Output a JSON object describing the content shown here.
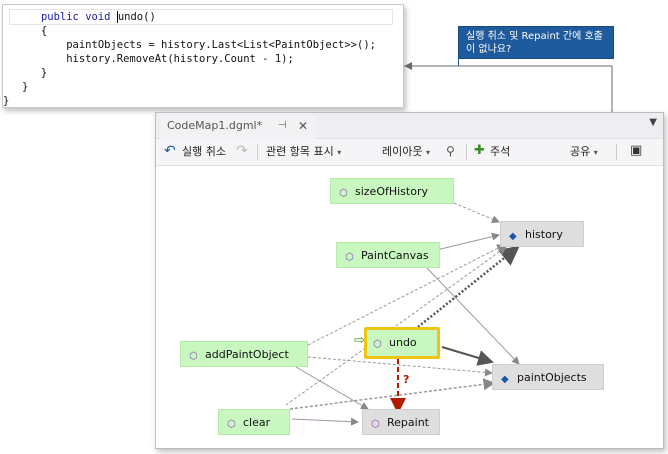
{
  "code": {
    "lines": [
      "      public void undo()",
      "      {",
      "          paintObjects = history.Last<List<PaintObject>>();",
      "          history.RemoveAt(history.Count - 1);",
      "      }",
      "   }",
      "}"
    ],
    "keyword_public": "public",
    "keyword_void": "void",
    "method_name": "undo",
    "method_suffix": "()"
  },
  "callout": {
    "text": "실행 취소 및 Repaint 간에 호출이 없나요?"
  },
  "window": {
    "tab_title": "CodeMap1.dgml*",
    "pin_icon": "pin-icon",
    "close_icon": "close-icon",
    "menu_icon": "chevron-down-icon"
  },
  "toolbar": {
    "undo_label": "실행 취소",
    "related_label": "관련 항목 표시",
    "layout_label": "레이아웃",
    "comment_label": "주석",
    "share_label": "공유"
  },
  "nodes": {
    "sizeOfHistory": "sizeOfHistory",
    "history": "history",
    "PaintCanvas": "PaintCanvas",
    "undo": "undo",
    "addPaintObject": "addPaintObject",
    "paintObjects": "paintObjects",
    "clear": "clear",
    "Repaint": "Repaint"
  },
  "edge_question": "?",
  "colors": {
    "method_bg": "#c8f8c0",
    "field_bg": "#dedede",
    "selected_border": "#f0c414",
    "question_edge": "#b31a00",
    "callout_bg": "#1f5a9c"
  }
}
